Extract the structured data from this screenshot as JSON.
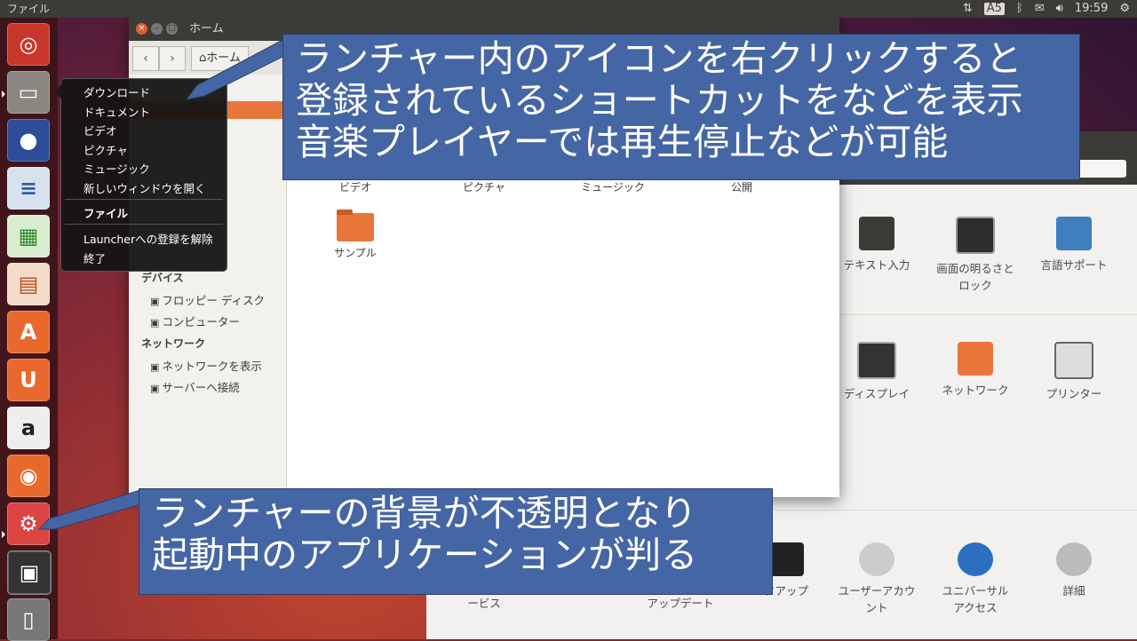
{
  "top_panel": {
    "app_title": "ファイル",
    "keyboard_indicator": "A5",
    "clock": "19:59"
  },
  "file_manager": {
    "title": "ホーム",
    "breadcrumb": "ホーム",
    "sidebar": {
      "devices_heading": "デバイス",
      "devices": [
        "フロッピー ディスク",
        "コンピューター"
      ],
      "network_heading": "ネットワーク",
      "network": [
        "ネットワークを表示",
        "サーバーへ接続"
      ]
    },
    "files": [
      "ビデオ",
      "ピクチャ",
      "ミュージック",
      "公開",
      "サンプル"
    ]
  },
  "settings": {
    "row1": [
      "テキスト入力",
      "画面の明るさと\nロック",
      "言語サポート"
    ],
    "row2": [
      "ディスプレイ",
      "ネットワーク",
      "プリンター"
    ],
    "row3": [
      "ービス",
      "アップデート",
      "クアップ",
      "ユーザーアカウ\nント",
      "ユニバーサル\nアクセス",
      "詳細"
    ]
  },
  "quicklist": {
    "items": [
      "ダウンロード",
      "ドキュメント",
      "ビデオ",
      "ピクチャ",
      "ミュージック",
      "新しいウィンドウを開く"
    ],
    "app_name": "ファイル",
    "unlock": "Launcherへの登録を解除",
    "quit": "終了"
  },
  "callouts": {
    "top": [
      "ランチャー内のアイコンを右クリックすると",
      "登録されているショートカットをなどを表示",
      "音楽プレイヤーでは再生停止などが可能"
    ],
    "bottom": [
      "ランチャーの背景が不透明となり",
      "起動中のアプリケーションが判る"
    ]
  },
  "colors": {
    "ubuntu_orange": "#e8763a",
    "panel": "#3c3b37",
    "callout": "#4566a4"
  }
}
